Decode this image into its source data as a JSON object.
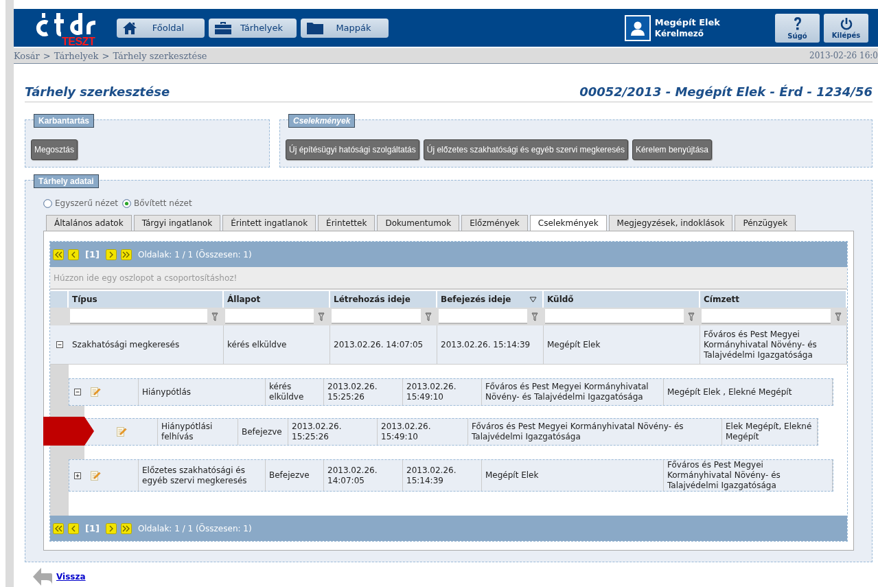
{
  "header": {
    "logo_badge": "TESZT",
    "nav": [
      {
        "label": "Főoldal"
      },
      {
        "label": "Tárhelyek"
      },
      {
        "label": "Mappák"
      }
    ],
    "user": {
      "name": "Megépít Elek",
      "role": "Kérelmező"
    },
    "tools": [
      {
        "label": "Súgó"
      },
      {
        "label": "Kilépés"
      }
    ]
  },
  "breadcrumb": {
    "items": [
      "Kosár",
      ">",
      "Tárhelyek",
      ">",
      "Tárhely szerkesztése"
    ],
    "timestamp": "2013-02-26 16:0"
  },
  "page_title": "Tárhely szerkesztése",
  "case_title": "00052/2013 - Megépít Elek - Érd - 1234/56",
  "panels": [
    {
      "legend": "Karbantartás",
      "italic": false,
      "buttons": [
        "Megosztás"
      ]
    },
    {
      "legend": "Cselekmények",
      "italic": true,
      "buttons": [
        "Új építésügyi hatósági szolgáltatás",
        "Új előzetes szakhatósági és egyéb szervi megkeresés",
        "Kérelem benyújtása"
      ]
    }
  ],
  "data_section": {
    "legend": "Tárhely adatai",
    "views": [
      {
        "label": "Egyszerű nézet",
        "selected": false
      },
      {
        "label": "Bővített nézet",
        "selected": true
      }
    ],
    "tabs": [
      {
        "label": "Általános adatok",
        "selected": false
      },
      {
        "label": "Tárgyi ingatlanok",
        "selected": false
      },
      {
        "label": "Érintett ingatlanok",
        "selected": false
      },
      {
        "label": "Érintettek",
        "selected": false
      },
      {
        "label": "Dokumentumok",
        "selected": false
      },
      {
        "label": "Előzmények",
        "selected": false
      },
      {
        "label": "Cselekmények",
        "selected": true
      },
      {
        "label": "Megjegyzések, indoklások",
        "selected": false
      },
      {
        "label": "Pénzügyek",
        "selected": false
      }
    ],
    "grid": {
      "pager_top": {
        "page": "[1]",
        "summary": "Oldalak: 1 / 1 (Összesen: 1)"
      },
      "group_hint": "Húzzon ide egy oszlopot a csoportosításhoz!",
      "columns": [
        {
          "label": "Típus",
          "sorted": false
        },
        {
          "label": "Állapot",
          "sorted": false
        },
        {
          "label": "Létrehozás ideje",
          "sorted": false
        },
        {
          "label": "Befejezés ideje",
          "sorted": true
        },
        {
          "label": "Küldő",
          "sorted": false
        },
        {
          "label": "Címzett",
          "sorted": false
        }
      ],
      "rows": [
        {
          "expanded": true,
          "cells": [
            "Szakhatósági megkeresés",
            "kérés elküldve",
            "2013.02.26. 14:07:05",
            "2013.02.26. 15:14:39",
            "Megépít Elek",
            "Főváros és Pest Megyei Kormányhivatal Növény- és Talajvédelmi Igazgatósága"
          ],
          "children": [
            {
              "expanded": true,
              "marked": false,
              "cells": [
                "Hiánypótlás",
                "kérés elküldve",
                "2013.02.26. 15:25:26",
                "2013.02.26. 15:49:10",
                "Főváros és Pest Megyei Kormányhivatal Növény- és Talajvédelmi Igazgatósága",
                "Megépít Elek , Elekné Megépít"
              ],
              "children": [
                {
                  "marked": true,
                  "cells": [
                    "Hiánypótlási felhívás",
                    "Befejezve",
                    "2013.02.26. 15:25:26",
                    "2013.02.26. 15:49:10",
                    "Főváros és Pest Megyei Kormányhivatal Növény- és Talajvédelmi Igazgatósága",
                    "Elek Megépít, Elekné Megépít"
                  ]
                }
              ]
            },
            {
              "expanded": false,
              "marked": false,
              "cells": [
                "Előzetes szakhatósági és egyéb szervi megkeresés",
                "Befejezve",
                "2013.02.26. 14:07:05",
                "2013.02.26. 15:14:39",
                "Megépít Elek",
                "Főváros és Pest Megyei Kormányhivatal Növény- és Talajvédelmi Igazgatósága"
              ]
            }
          ]
        }
      ],
      "pager_bottom": {
        "page": "[1]",
        "summary": "Oldalak: 1 / 1 (Összesen: 1)"
      }
    }
  },
  "back_link": "Vissza"
}
